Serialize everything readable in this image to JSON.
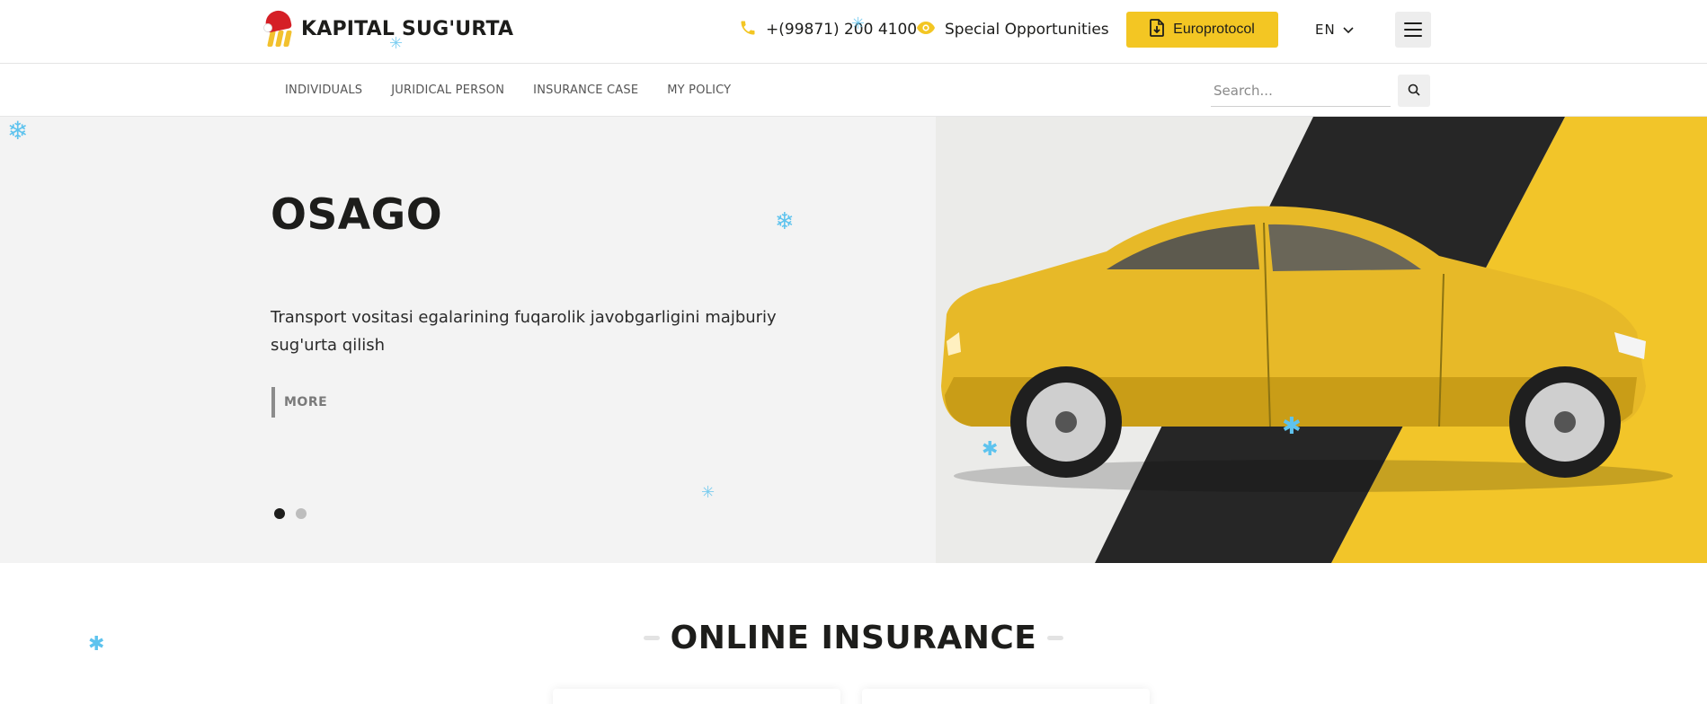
{
  "header": {
    "logo_text": "KAPITAL SUG'URTA",
    "phone": "+(99871) 200 4100",
    "special_label": "Special Opportunities",
    "europrotocol_label": "Europrotocol",
    "language": "EN"
  },
  "nav": {
    "items": [
      {
        "label": "INDIVIDUALS"
      },
      {
        "label": "JURIDICAL PERSON"
      },
      {
        "label": "INSURANCE CASE"
      },
      {
        "label": "MY POLICY"
      }
    ],
    "search_placeholder": "Search..."
  },
  "hero": {
    "title": "OSAGO",
    "description": "Transport vositasi egalarining fuqarolik javobgarligini majburiy sug'urta qilish",
    "more_label": "MORE",
    "slide_count": 2,
    "active_slide": 1
  },
  "online": {
    "title": "ONLINE INSURANCE"
  },
  "colors": {
    "brand_yellow": "#f3c623",
    "dark": "#1d1d1b",
    "hat_red": "#d51f26",
    "snow_blue": "#5ec3ee"
  },
  "icons": [
    "phone-icon",
    "eye-icon",
    "document-download-icon",
    "chevron-down-icon",
    "hamburger-menu-icon",
    "search-icon",
    "snowflake-icon"
  ]
}
